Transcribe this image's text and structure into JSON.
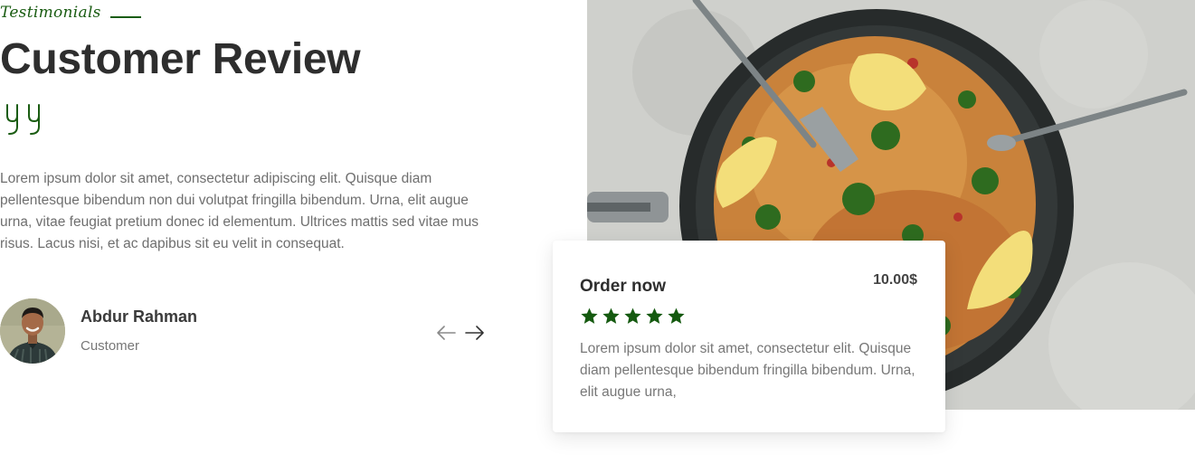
{
  "section": {
    "eyebrow": "Testimonials",
    "title": "Customer Review",
    "quote_icon": "double-quote-icon",
    "review_text": "Lorem ipsum dolor sit amet, consectetur adipiscing elit. Quisque diam pellentesque bibendum non dui volutpat fringilla bibendum. Urna, elit augue urna, vitae feugiat pretium donec id elementum. Ultrices mattis sed vitae mus risus. Lacus nisi, et ac dapibus sit eu velit in consequat."
  },
  "author": {
    "name": "Abdur Rahman",
    "role": "Customer"
  },
  "navigation": {
    "prev_icon": "arrow-left-icon",
    "next_icon": "arrow-right-icon"
  },
  "order_card": {
    "title": "Order now",
    "price": "10.00$",
    "rating": 5,
    "rating_max": 5,
    "description": "Lorem ipsum dolor sit amet, consectetur elit. Quisque diam pellentesque bibendum fringilla bibendum. Urna, elit augue urna,"
  },
  "colors": {
    "accent": "#1a5c12",
    "heading": "#2e2e2e",
    "body_text": "#6f6f6f"
  }
}
